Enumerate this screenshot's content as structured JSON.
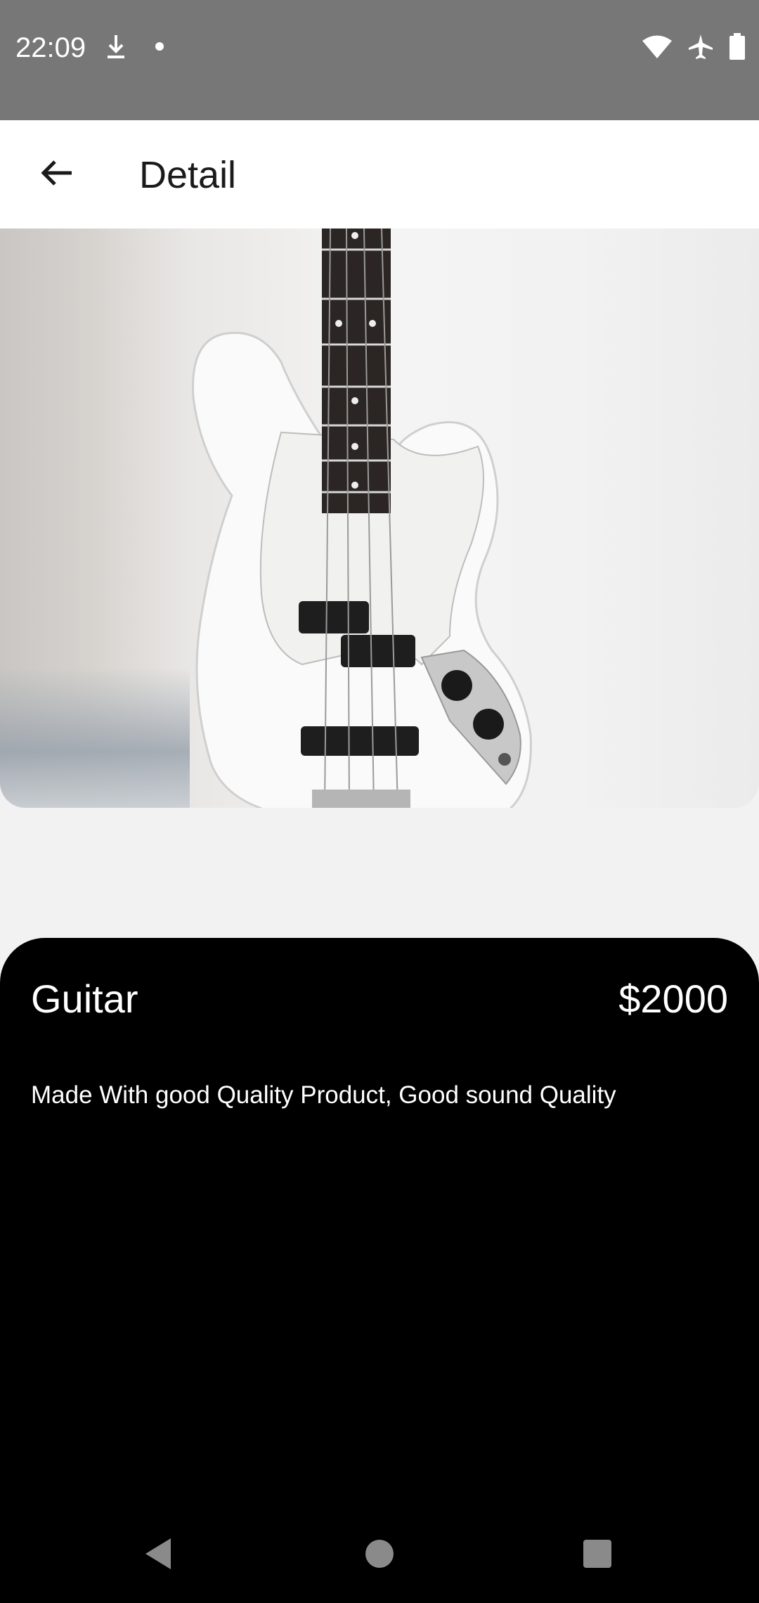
{
  "status_bar": {
    "time": "22:09",
    "icons_left": [
      "download-icon",
      "dot-icon"
    ],
    "icons_right": [
      "wifi-icon",
      "airplane-icon",
      "battery-icon"
    ]
  },
  "app_bar": {
    "title": "Detail",
    "back_icon": "arrow-left-icon"
  },
  "product": {
    "name": "Guitar",
    "price": "$2000",
    "description": "Made With good Quality Product, Good sound Quality",
    "image_subject": "white bass guitar"
  },
  "nav_bar": {
    "buttons": [
      "back-triangle-icon",
      "home-circle-icon",
      "recents-square-icon"
    ]
  },
  "colors": {
    "status_bar": "#777777",
    "app_bar": "#ffffff",
    "background": "#f2f2f2",
    "card": "#000000",
    "text_on_card": "#ffffff"
  }
}
